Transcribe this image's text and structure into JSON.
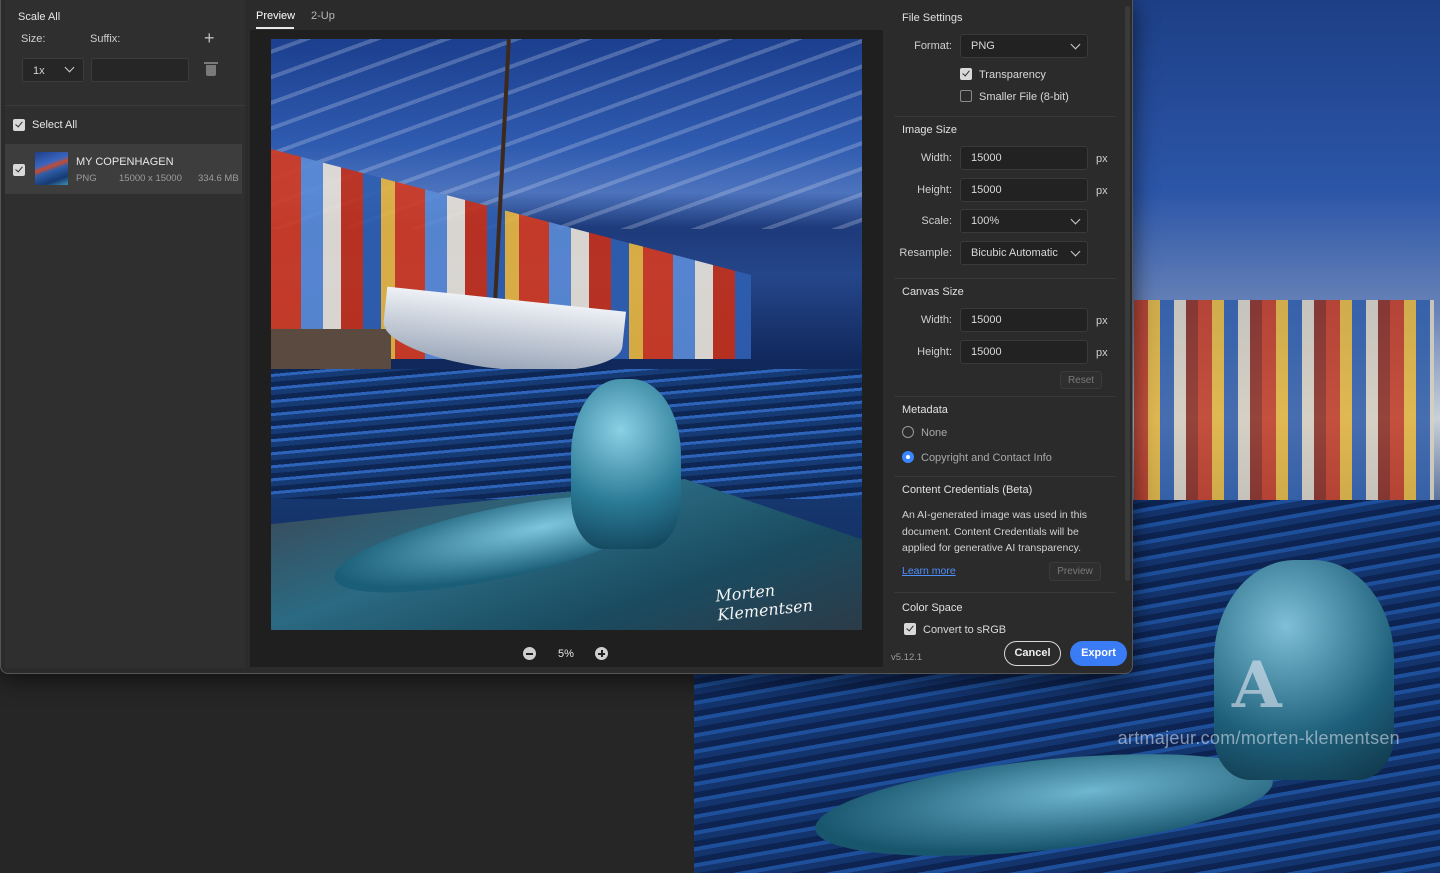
{
  "left_panel": {
    "title": "Scale All",
    "size_label": "Size:",
    "suffix_label": "Suffix:",
    "scale_value": "1x",
    "suffix_value": "",
    "select_all_label": "Select All",
    "select_all_checked": true,
    "asset": {
      "name": "MY COPENHAGEN",
      "format": "PNG",
      "dimensions": "15000 x 15000",
      "size": "334.6 MB",
      "checked": true
    }
  },
  "preview": {
    "tabs": [
      {
        "label": "Preview",
        "active": true
      },
      {
        "label": "2-Up",
        "active": false
      }
    ],
    "zoom": "5%"
  },
  "file_settings": {
    "title": "File Settings",
    "format_label": "Format:",
    "format_value": "PNG",
    "transparency_label": "Transparency",
    "transparency_checked": true,
    "smaller_file_label": "Smaller File (8-bit)",
    "smaller_file_checked": false
  },
  "image_size": {
    "title": "Image Size",
    "width_label": "Width:",
    "width_value": "15000",
    "height_label": "Height:",
    "height_value": "15000",
    "unit": "px",
    "scale_label": "Scale:",
    "scale_value": "100%",
    "resample_label": "Resample:",
    "resample_value": "Bicubic Automatic"
  },
  "canvas_size": {
    "title": "Canvas Size",
    "width_label": "Width:",
    "width_value": "15000",
    "height_label": "Height:",
    "height_value": "15000",
    "unit": "px",
    "reset_label": "Reset"
  },
  "metadata": {
    "title": "Metadata",
    "options": [
      {
        "label": "None",
        "selected": false
      },
      {
        "label": "Copyright and Contact Info",
        "selected": true
      }
    ]
  },
  "content_credentials": {
    "title": "Content Credentials (Beta)",
    "text": "An AI-generated image was used in this document. Content Credentials will be applied for generative AI transparency.",
    "learn_more": "Learn more",
    "preview_label": "Preview"
  },
  "color_space": {
    "title": "Color Space",
    "convert_label": "Convert to sRGB",
    "convert_checked": true
  },
  "footer": {
    "version": "v5.12.1",
    "cancel": "Cancel",
    "export": "Export"
  },
  "artwork": {
    "signature": "Morten Klementsen",
    "watermark": "artmajeur.com/morten-klementsen"
  },
  "colors": {
    "accent": "#3a7cf5",
    "link": "#4e8fff",
    "dialog_bg": "#2b2b2b"
  }
}
